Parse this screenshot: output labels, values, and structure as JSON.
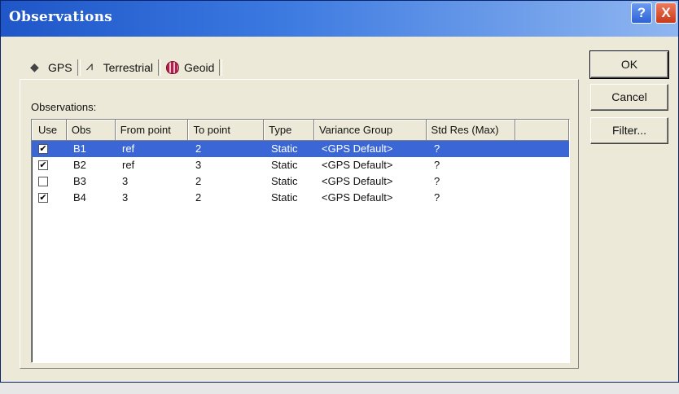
{
  "window": {
    "title": "Observations",
    "help_glyph": "?",
    "close_glyph": "X"
  },
  "tabs": [
    {
      "label": "GPS",
      "icon": "gps-icon",
      "active": true
    },
    {
      "label": "Terrestrial",
      "icon": "terrestrial-icon",
      "active": false
    },
    {
      "label": "Geoid",
      "icon": "geoid-icon",
      "active": false
    }
  ],
  "list": {
    "label": "Observations:",
    "columns": [
      "Use",
      "Obs",
      "From point",
      "To point",
      "Type",
      "Variance Group",
      "Std Res (Max)"
    ],
    "rows": [
      {
        "use": true,
        "obs": "B1",
        "from": "ref",
        "to": "2",
        "type": "Static",
        "variance": "<GPS Default>",
        "std": "?",
        "selected": true
      },
      {
        "use": true,
        "obs": "B2",
        "from": "ref",
        "to": "3",
        "type": "Static",
        "variance": "<GPS Default>",
        "std": "?",
        "selected": false
      },
      {
        "use": false,
        "obs": "B3",
        "from": "3",
        "to": "2",
        "type": "Static",
        "variance": "<GPS Default>",
        "std": "?",
        "selected": false
      },
      {
        "use": true,
        "obs": "B4",
        "from": "3",
        "to": "2",
        "type": "Static",
        "variance": "<GPS Default>",
        "std": "?",
        "selected": false
      }
    ]
  },
  "buttons": {
    "ok": "OK",
    "cancel": "Cancel",
    "filter": "Filter..."
  },
  "colors": {
    "selection": "#3b67d6",
    "titlebar": "#1f56c8"
  }
}
